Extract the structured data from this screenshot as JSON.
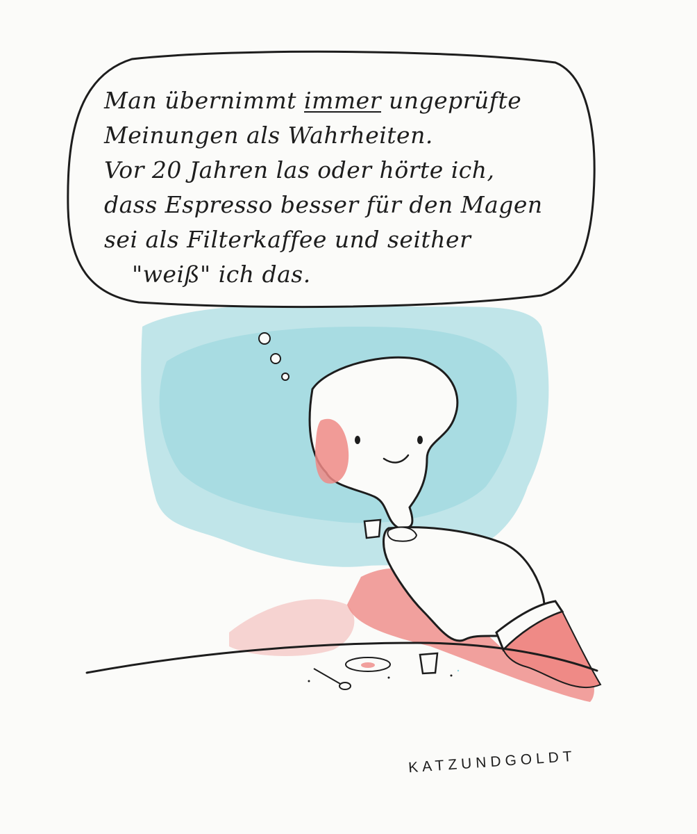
{
  "speech": {
    "line1_a": "Man übernimmt ",
    "line1_em": "immer",
    "line1_b": " ungeprüfte",
    "line2": "Meinungen als Wahrheiten.",
    "line3": "Vor 20 Jahren las oder hörte ich,",
    "line4": "dass Espresso besser für den Magen",
    "line5": "sei als Filterkaffee und seither",
    "line6": "\"weiß\" ich das."
  },
  "signature": "KATZUNDGOLDT",
  "colors": {
    "ink": "#1d1d1d",
    "watercolor_blue": "#8fd3dc",
    "watercolor_red": "#ef8a86",
    "paper": "#fbfbf9"
  }
}
